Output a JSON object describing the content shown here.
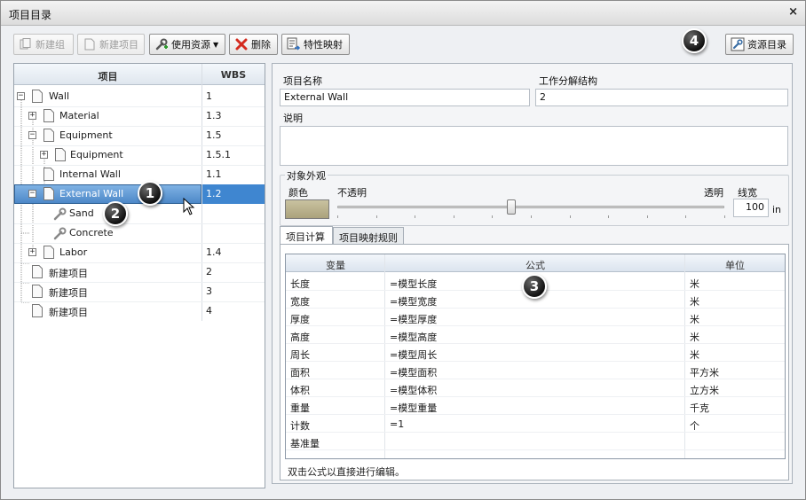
{
  "window": {
    "title": "项目目录",
    "close": "×"
  },
  "toolbar": {
    "new_group": "新建组",
    "new_item": "新建项目",
    "use_resource": "使用资源",
    "delete": "删除",
    "property_map": "特性映射",
    "resource_catalog": "资源目录"
  },
  "callouts": [
    "1",
    "2",
    "3",
    "4"
  ],
  "tree": {
    "col_item": "项目",
    "col_wbs": "WBS",
    "rows": [
      {
        "label": "Wall",
        "wbs": "1"
      },
      {
        "label": "Material",
        "wbs": "1.3"
      },
      {
        "label": "Equipment",
        "wbs": "1.5"
      },
      {
        "label": "Equipment",
        "wbs": "1.5.1"
      },
      {
        "label": "Internal Wall",
        "wbs": "1.1"
      },
      {
        "label": "External Wall",
        "wbs": "1.2"
      },
      {
        "label": "Sand",
        "wbs": ""
      },
      {
        "label": "Concrete",
        "wbs": ""
      },
      {
        "label": "Labor",
        "wbs": "1.4"
      },
      {
        "label": "新建项目",
        "wbs": "2"
      },
      {
        "label": "新建项目",
        "wbs": "3"
      },
      {
        "label": "新建项目",
        "wbs": "4"
      }
    ]
  },
  "details": {
    "name_label": "项目名称",
    "name_value": "External Wall",
    "wbs_label": "工作分解结构",
    "wbs_value": "2",
    "desc_label": "说明",
    "desc_value": "",
    "appearance_label": "对象外观",
    "color_label": "颜色",
    "opaque_label": "不透明",
    "transparent_label": "透明",
    "line_width_label": "线宽",
    "line_width_value": "100",
    "line_width_unit": "in",
    "transparency_level": 0.45
  },
  "tabs": {
    "calc": "项目计算",
    "mapping": "项目映射规则"
  },
  "grid": {
    "col_variable": "变量",
    "col_formula": "公式",
    "col_unit": "单位",
    "rows": [
      {
        "variable": "长度",
        "formula": "=模型长度",
        "unit": "米"
      },
      {
        "variable": "宽度",
        "formula": "=模型宽度",
        "unit": "米"
      },
      {
        "variable": "厚度",
        "formula": "=模型厚度",
        "unit": "米"
      },
      {
        "variable": "高度",
        "formula": "=模型高度",
        "unit": "米"
      },
      {
        "variable": "周长",
        "formula": "=模型周长",
        "unit": "米"
      },
      {
        "variable": "面积",
        "formula": "=模型面积",
        "unit": "平方米"
      },
      {
        "variable": "体积",
        "formula": "=模型体积",
        "unit": "立方米"
      },
      {
        "variable": "重量",
        "formula": "=模型重量",
        "unit": "千克"
      },
      {
        "variable": "计数",
        "formula": "=1",
        "unit": "个"
      },
      {
        "variable": "基准量",
        "formula": "",
        "unit": ""
      }
    ],
    "hint": "双击公式以直接进行编辑。"
  },
  "colors": {
    "selection": "#4d88c8",
    "swatch": "#bdb58f"
  }
}
